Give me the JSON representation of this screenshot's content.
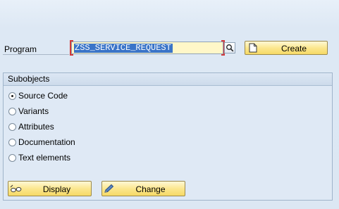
{
  "program": {
    "label": "Program",
    "value": "ZSS_SERVICE_REQUEST",
    "value_help_icon": "search-icon",
    "create_button": {
      "label": "Create",
      "icon": "new-document-icon"
    }
  },
  "subobjects": {
    "title": "Subobjects",
    "options": [
      {
        "label": "Source Code",
        "selected": true
      },
      {
        "label": "Variants",
        "selected": false
      },
      {
        "label": "Attributes",
        "selected": false
      },
      {
        "label": "Documentation",
        "selected": false
      },
      {
        "label": "Text elements",
        "selected": false
      }
    ]
  },
  "buttons": {
    "display": {
      "label": "Display",
      "icon": "glasses-icon"
    },
    "change": {
      "label": "Change",
      "icon": "pencil-icon"
    }
  },
  "colors": {
    "background": "#dce7f3",
    "input_required_bracket": "#d23a3a",
    "input_background": "#fff7c8",
    "selection_highlight": "#3a74c8",
    "button_fill": "#fbe78f"
  }
}
